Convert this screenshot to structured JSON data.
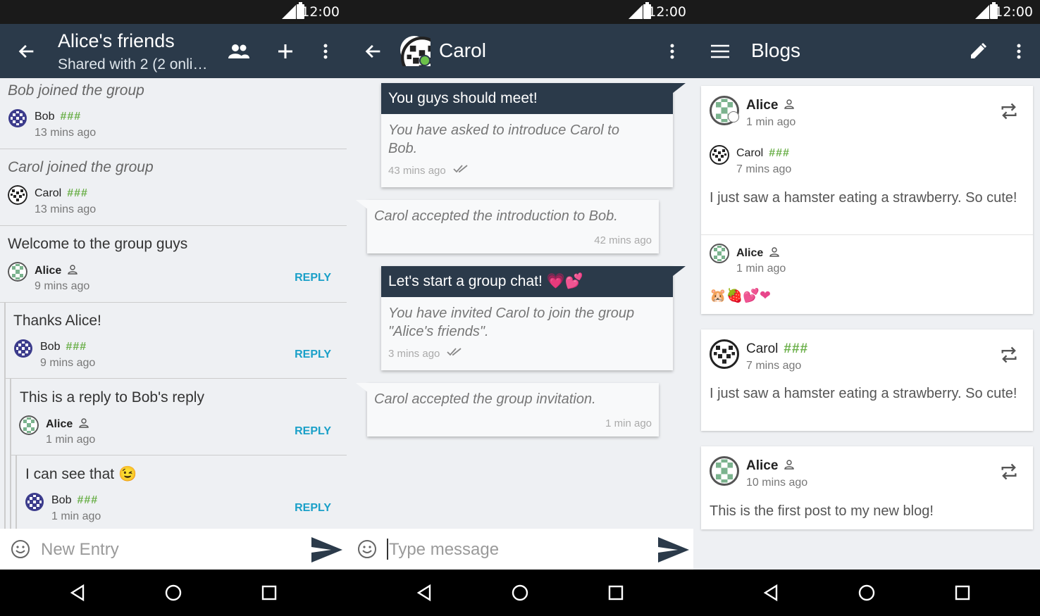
{
  "status": {
    "time": "12:00"
  },
  "forum": {
    "title": "Alice's friends",
    "subtitle": "Shared with 2 (2 onli…",
    "items": [
      {
        "text": "Bob joined the group",
        "author": "Bob",
        "hash": "###",
        "time": "13 mins ago"
      },
      {
        "text": "Carol joined the group",
        "author": "Carol",
        "hash": "###",
        "time": "13 mins ago"
      },
      {
        "text": "Welcome to the group guys",
        "author": "Alice",
        "time": "9 mins ago",
        "reply": "REPLY"
      },
      {
        "text": "Thanks Alice!",
        "author": "Bob",
        "hash": "###",
        "time": "9 mins ago",
        "reply": "REPLY"
      },
      {
        "text": "This is a reply to Bob's reply",
        "author": "Alice",
        "time": "1 min ago",
        "reply": "REPLY"
      },
      {
        "text": "I can see that",
        "emoji": "😉",
        "author": "Bob",
        "hash": "###",
        "time": "1 min ago",
        "reply": "REPLY"
      }
    ],
    "input_placeholder": "New Entry"
  },
  "chat": {
    "title": "Carol",
    "messages": [
      {
        "head": "You guys should meet!",
        "body": "You have asked to introduce Carol to Bob.",
        "time": "43 mins ago"
      },
      {
        "body": "Carol accepted the introduction to Bob.",
        "time": "42 mins ago"
      },
      {
        "head": "Let's start a group chat!",
        "emoji": "💗💕",
        "body": "You have invited Carol to join the group \"Alice's friends\".",
        "time": "3 mins ago"
      },
      {
        "body": "Carol accepted the group invitation.",
        "time": "1 min ago"
      }
    ],
    "input_placeholder": "Type message"
  },
  "blogs": {
    "title": "Blogs",
    "posts": [
      {
        "author": "Alice",
        "time": "1 min ago",
        "inner": {
          "author": "Carol",
          "hash": "###",
          "time": "7 mins ago",
          "text": "I just saw a hamster eating a strawberry. So cute!"
        },
        "comment": {
          "author": "Alice",
          "time": "1 min ago",
          "emoji": "🐹🍓💕❤"
        }
      },
      {
        "author": "Carol",
        "hash": "###",
        "time": "7 mins ago",
        "text": "I just saw a hamster eating a strawberry. So cute!"
      },
      {
        "author": "Alice",
        "time": "10 mins ago",
        "text": "This is the first post to my new blog!"
      }
    ]
  },
  "colors": {
    "toolbar": "#2b3a4a",
    "accent": "#1aa0c8",
    "hash": "#6cb04b",
    "background": "#eef0f3"
  }
}
